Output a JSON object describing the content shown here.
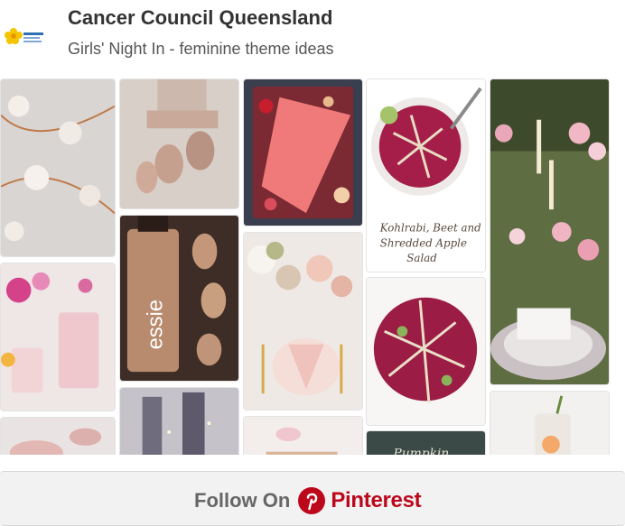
{
  "header": {
    "owner_name": "Cancer Council Queensland",
    "board_name": "Girls' Night In - feminine theme ideas",
    "logo_icon": "daffodil-logo-icon"
  },
  "pins": {
    "p3_line1": "Kohlrabi, Beet and",
    "p3_line2": "Shredded Apple",
    "p3_line3": "Salad",
    "p2_brand": "essie",
    "p3_bottom": "Pumpkin"
  },
  "footer": {
    "follow_label": "Follow On",
    "brand_label": "Pinterest",
    "brand_color": "#bd081c",
    "icon": "pinterest-logo-icon"
  }
}
